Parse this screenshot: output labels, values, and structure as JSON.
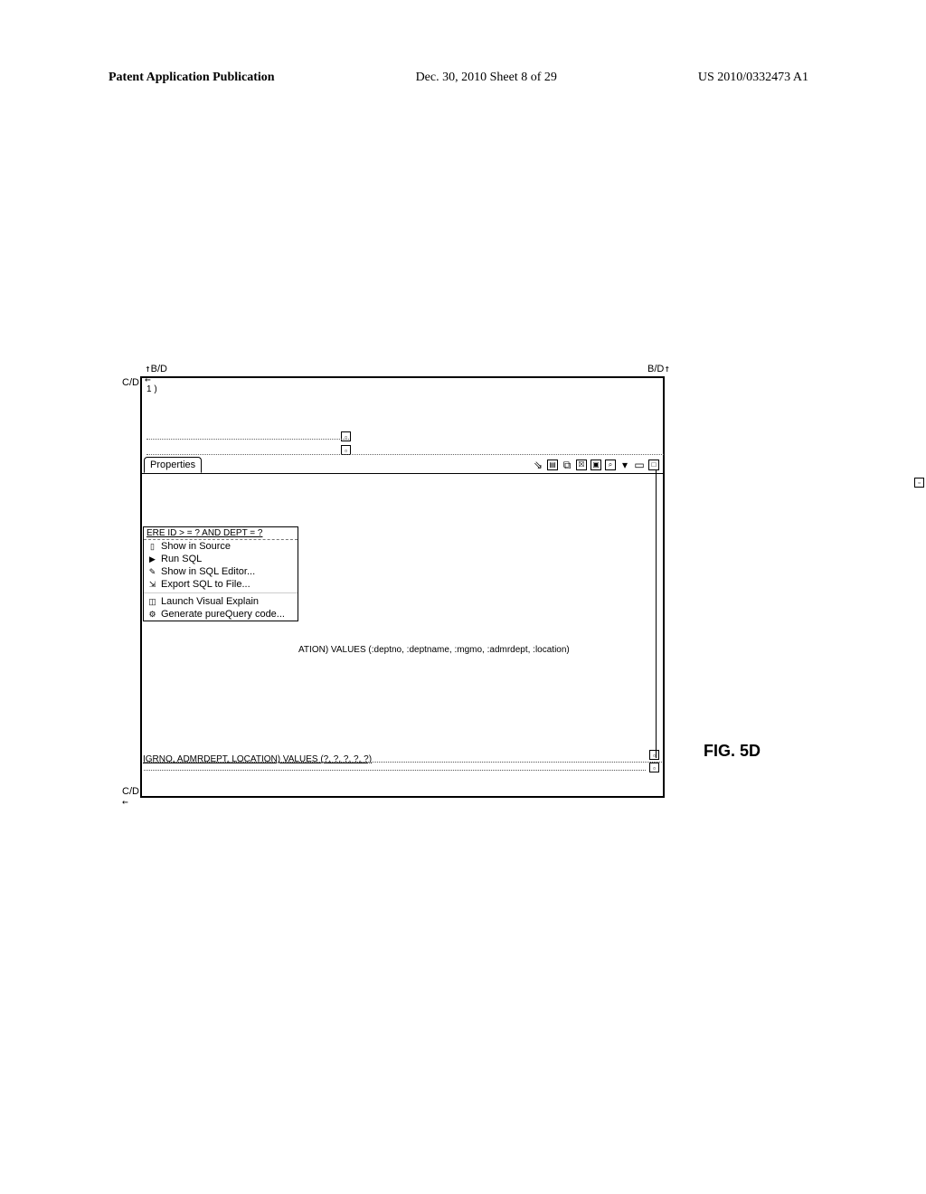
{
  "header": {
    "left": "Patent Application Publication",
    "mid": "Dec. 30, 2010  Sheet 8 of 29",
    "right": "US 2010/0332473 A1"
  },
  "figure_label": "FIG. 5D",
  "corners": {
    "top_left": "B/D",
    "top_right": "B/D",
    "mid_left": "C/D",
    "bot_left": "C/D"
  },
  "frag_top_line1": "1 )",
  "properties_tab": "Properties",
  "toolbar_icons": [
    "pin-icon",
    "page-icon",
    "tree-icon",
    "sq-icon",
    "db-icon",
    "zoom-icon",
    "dropdown-icon",
    "min-icon",
    "max-icon"
  ],
  "ctx_header": "ERE ID > = ? AND DEPT = ?",
  "ctx_items": [
    {
      "icon": "doc",
      "label": "Show in Source"
    },
    {
      "icon": "run",
      "label": "Run SQL"
    },
    {
      "icon": "edit",
      "label": "Show in SQL Editor..."
    },
    {
      "icon": "exp",
      "label": "Export SQL to File..."
    },
    {
      "icon": "vis",
      "label": "Launch Visual Explain",
      "sep": true
    },
    {
      "icon": "gen",
      "label": "Generate pureQuery code..."
    }
  ],
  "query_tail": "ATION) VALUES (:deptno, :deptname, :mgmo, :admrdept, :location)",
  "frag_bottom": "IGRNO, ADMRDEPT, LOCATION) VALUES (?, ?, ?, ?, ?)"
}
